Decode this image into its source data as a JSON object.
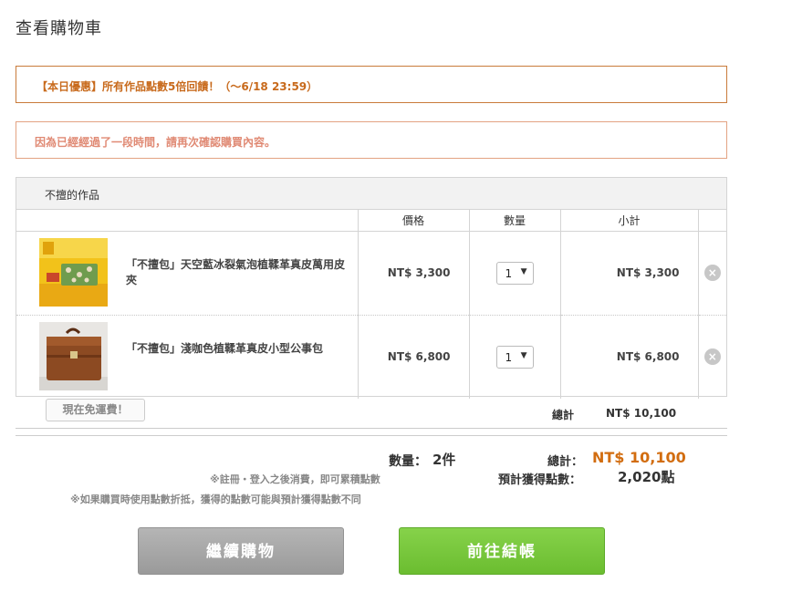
{
  "page": {
    "title": "查看購物車"
  },
  "notices": {
    "promo": "【本日優惠】所有作品點數5倍回饋！（～6/18 23:59）",
    "warning": "因為已經經過了一段時間，請再次確認購買內容。"
  },
  "shop": {
    "header": "不擅的作品",
    "columns": {
      "price": "價格",
      "quantity": "數量",
      "subtotal": "小計"
    },
    "items": [
      {
        "name": "「不擅包」天空藍冰裂氣泡植鞣革真皮萬用皮夾",
        "price": "NT$ 3,300",
        "quantity": "1",
        "subtotal": "NT$ 3,300",
        "delete_icon": "×"
      },
      {
        "name": "「不擅包」淺咖色植鞣革真皮小型公事包",
        "price": "NT$ 6,800",
        "quantity": "1",
        "subtotal": "NT$ 6,800",
        "delete_icon": "×"
      }
    ],
    "free_shipping": "現在免運費！",
    "total_label": "總計",
    "total_value": "NT$ 10,100"
  },
  "summary": {
    "qty_label": "數量：",
    "qty_value": "2件",
    "total_label": "總計：",
    "total_value": "NT$ 10,100",
    "points_label": "預計獲得點數：",
    "points_value": "2,020點",
    "note_login": "※註冊・登入之後消費，即可累積點數",
    "note_points": "※如果購買時使用點數折抵，獲得的點數可能與預計獲得點數不同"
  },
  "buttons": {
    "continue": "繼續購物",
    "checkout": "前往結帳"
  },
  "colors": {
    "accent": "#d26d10",
    "checkout_green": "#6bbd30",
    "continue_gray": "#a6a6a6"
  }
}
